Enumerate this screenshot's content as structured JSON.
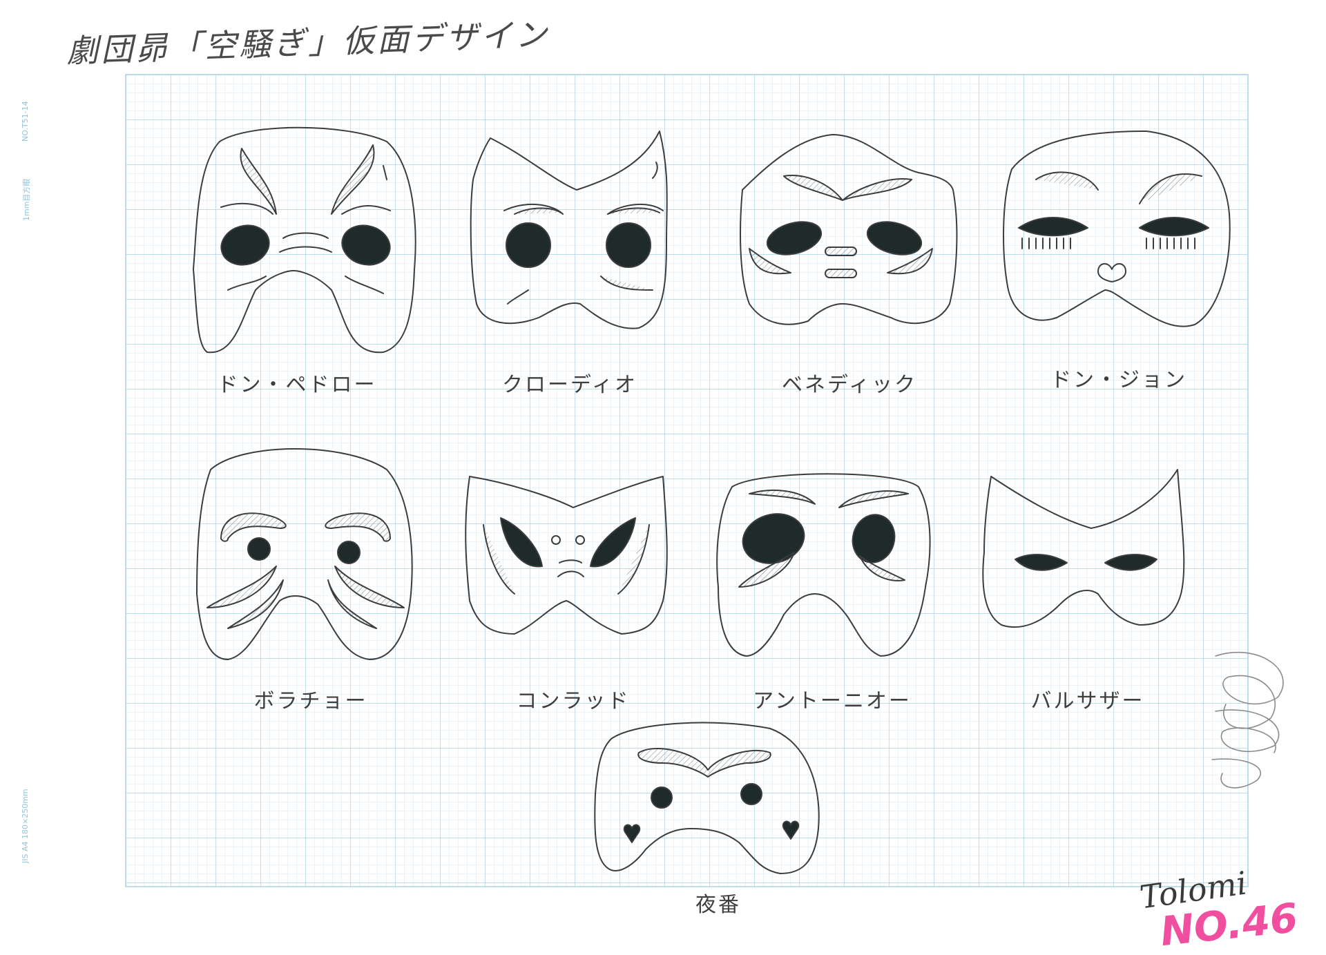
{
  "sheet_title": "劇団昴「空騒ぎ」仮面デザイン",
  "margin_labels": {
    "code": "NO.T51-14",
    "grid": "1mm目方眼",
    "size": "JIS A4 180×250mm"
  },
  "masks": [
    {
      "name": "ドン・ペドロー",
      "icon": "mask-don-pedro"
    },
    {
      "name": "クローディオ",
      "icon": "mask-claudio"
    },
    {
      "name": "ベネディック",
      "icon": "mask-benedick"
    },
    {
      "name": "ドン・ジョン",
      "icon": "mask-don-john"
    },
    {
      "name": "ボラチョー",
      "icon": "mask-borachio"
    },
    {
      "name": "コンラッド",
      "icon": "mask-conrade"
    },
    {
      "name": "アントーニオー",
      "icon": "mask-antonio"
    },
    {
      "name": "バルサザー",
      "icon": "mask-balthasar"
    },
    {
      "name": "夜番",
      "icon": "mask-watchman"
    }
  ],
  "signature": "Tolomi",
  "sheet_number": "NO.46",
  "colors": {
    "paper": "#ffffff",
    "grid_minor": "#d4eaf3",
    "grid_major": "#a8d3e6",
    "pencil": "#3c3c3c",
    "ink_fill": "#1f2a2a",
    "number_pink": "#ef4f9e"
  }
}
